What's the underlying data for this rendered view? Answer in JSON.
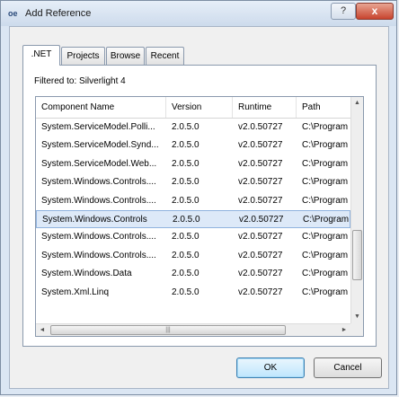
{
  "window": {
    "title": "Add Reference",
    "app_icon": "oe",
    "help_label": "?",
    "close_label": "x"
  },
  "tabs": [
    {
      "label": ".NET",
      "active": true
    },
    {
      "label": "Projects",
      "active": false
    },
    {
      "label": "Browse",
      "active": false
    },
    {
      "label": "Recent",
      "active": false
    }
  ],
  "filter_label": "Filtered to: Silverlight 4",
  "columns": [
    "Component Name",
    "Version",
    "Runtime",
    "Path"
  ],
  "rows": [
    {
      "name": "System.ServiceModel.Polli...",
      "version": "2.0.5.0",
      "runtime": "v2.0.50727",
      "path": "C:\\Program"
    },
    {
      "name": "System.ServiceModel.Synd...",
      "version": "2.0.5.0",
      "runtime": "v2.0.50727",
      "path": "C:\\Program"
    },
    {
      "name": "System.ServiceModel.Web...",
      "version": "2.0.5.0",
      "runtime": "v2.0.50727",
      "path": "C:\\Program"
    },
    {
      "name": "System.Windows.Controls....",
      "version": "2.0.5.0",
      "runtime": "v2.0.50727",
      "path": "C:\\Program"
    },
    {
      "name": "System.Windows.Controls....",
      "version": "2.0.5.0",
      "runtime": "v2.0.50727",
      "path": "C:\\Program"
    },
    {
      "name": "System.Windows.Controls",
      "version": "2.0.5.0",
      "runtime": "v2.0.50727",
      "path": "C:\\Program",
      "selected": true
    },
    {
      "name": "System.Windows.Controls....",
      "version": "2.0.5.0",
      "runtime": "v2.0.50727",
      "path": "C:\\Program"
    },
    {
      "name": "System.Windows.Controls....",
      "version": "2.0.5.0",
      "runtime": "v2.0.50727",
      "path": "C:\\Program"
    },
    {
      "name": "System.Windows.Data",
      "version": "2.0.5.0",
      "runtime": "v2.0.50727",
      "path": "C:\\Program"
    },
    {
      "name": "System.Xml.Linq",
      "version": "2.0.5.0",
      "runtime": "v2.0.50727",
      "path": "C:\\Program"
    }
  ],
  "scroll_glyphs": {
    "up": "▲",
    "down": "▼",
    "left": "◄",
    "right": "►",
    "grip": "|||"
  },
  "buttons": {
    "ok": "OK",
    "cancel": "Cancel"
  },
  "colors": {
    "selection": "#dde9f8",
    "selection_border": "#8fb2de",
    "close": "#c8442e"
  },
  "icons": [
    "app-icon",
    "help-icon",
    "close-icon",
    "scroll-up-icon",
    "scroll-down-icon",
    "scroll-left-icon",
    "scroll-right-icon"
  ]
}
